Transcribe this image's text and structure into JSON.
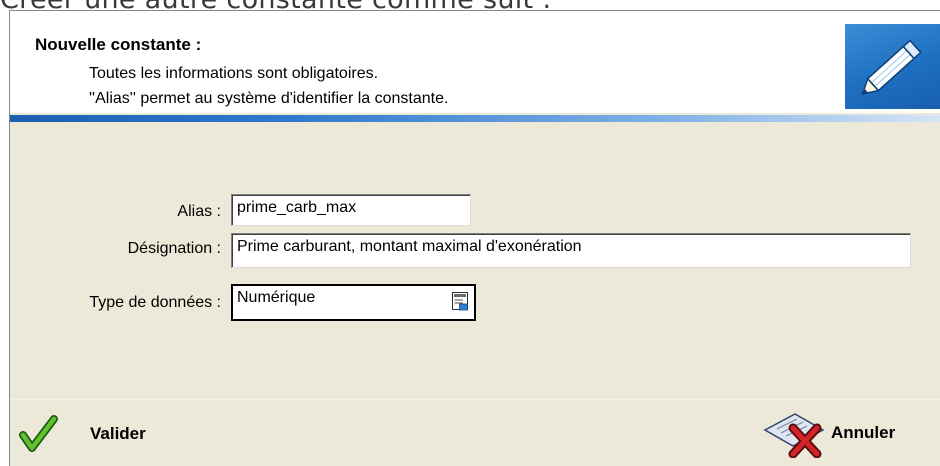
{
  "caption": "Créer une autre constante comme suit :",
  "header": {
    "title": "Nouvelle constante :",
    "info_line1": "Toutes les informations  sont obligatoires.",
    "info_line2": "''Alias'' permet au système d'identifier la constante."
  },
  "form": {
    "alias_label": "Alias :",
    "alias_value": "prime_carb_max",
    "designation_label": "Désignation :",
    "designation_value": "Prime carburant, montant maximal d'exonération",
    "type_label": "Type de données :",
    "type_value": "Numérique"
  },
  "footer": {
    "validate_label": "Valider",
    "cancel_label": "Annuler"
  },
  "colors": {
    "dialog_bg": "#ece9d8",
    "accent_blue": "#1f6fc0",
    "check_green": "#2e8b1f",
    "cancel_red": "#c0171d"
  },
  "icons": [
    "pencil-icon",
    "list-select-icon",
    "check-icon",
    "cancel-icon"
  ]
}
